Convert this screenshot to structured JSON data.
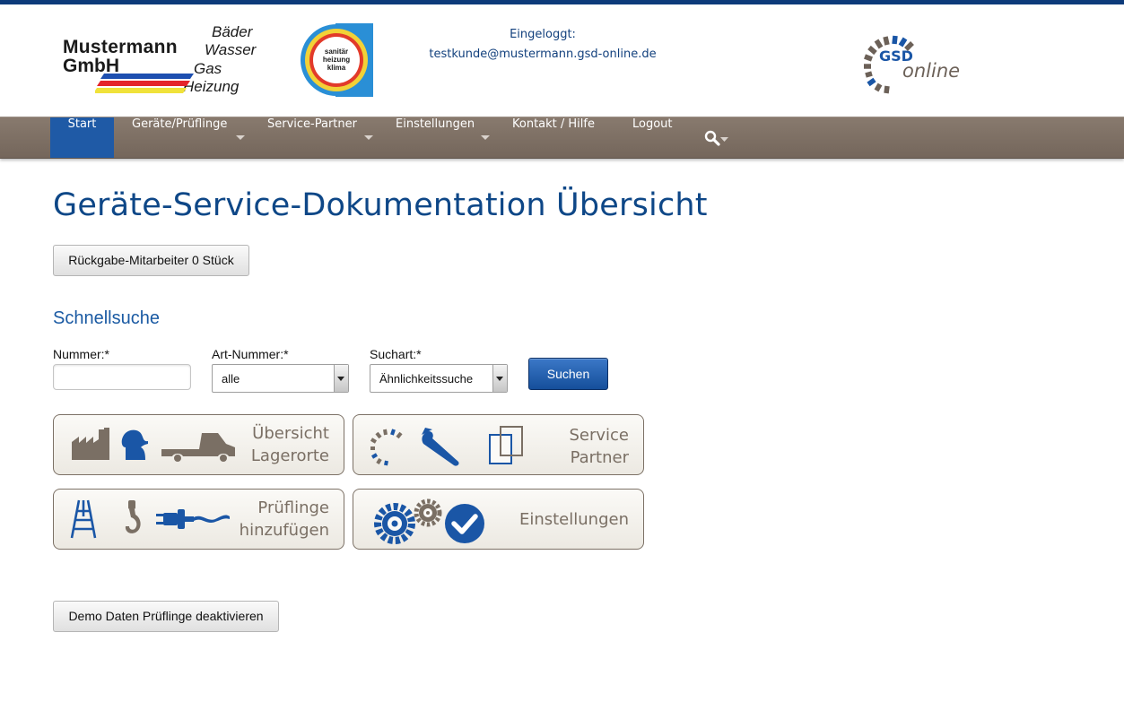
{
  "header": {
    "company_logo": {
      "line1": "Mustermann",
      "line2": "GmbH",
      "trades": [
        "Bäder",
        "Wasser",
        "Gas",
        "Heizung"
      ]
    },
    "seal": {
      "lines": [
        "sanitär",
        "heizung",
        "klima"
      ]
    },
    "login_label": "Eingeloggt:",
    "login_email": "testkunde@mustermann.gsd-online.de",
    "gsd_logo": {
      "gsd": "GSD",
      "online": "online"
    }
  },
  "nav": {
    "items": [
      {
        "label": "Start",
        "active": true
      },
      {
        "label": "Geräte/Prüflinge",
        "dropdown": true
      },
      {
        "label": "Service-Partner",
        "dropdown": true
      },
      {
        "label": "Einstellungen",
        "dropdown": true
      },
      {
        "label": "Kontakt / Hilfe"
      },
      {
        "label": "Logout"
      }
    ],
    "search_icon": "search-icon"
  },
  "page_title": "Geräte-Service-Dokumentation Übersicht",
  "return_button": "Rückgabe-Mitarbeiter 0 Stück",
  "quicksearch": {
    "title": "Schnellsuche",
    "nummer_label": "Nummer:*",
    "nummer_value": "",
    "artnummer_label": "Art-Nummer:*",
    "artnummer_value": "alle",
    "suchart_label": "Suchart:*",
    "suchart_value": "Ähnlichkeitssuche",
    "search_button": "Suchen"
  },
  "tiles": [
    {
      "line1": "Übersicht",
      "line2": "Lagerorte"
    },
    {
      "line1": "Service",
      "line2": "Partner"
    },
    {
      "line1": "Prüflinge",
      "line2": "hinzufügen"
    },
    {
      "line1": "Einstellungen"
    }
  ],
  "demo_button": "Demo Daten Prüflinge deaktivieren",
  "colors": {
    "brand_blue": "#0e4787",
    "nav_brown": "#7e7064",
    "active_blue": "#1f5aa6",
    "tile_icon_brown": "#7a6f64"
  }
}
